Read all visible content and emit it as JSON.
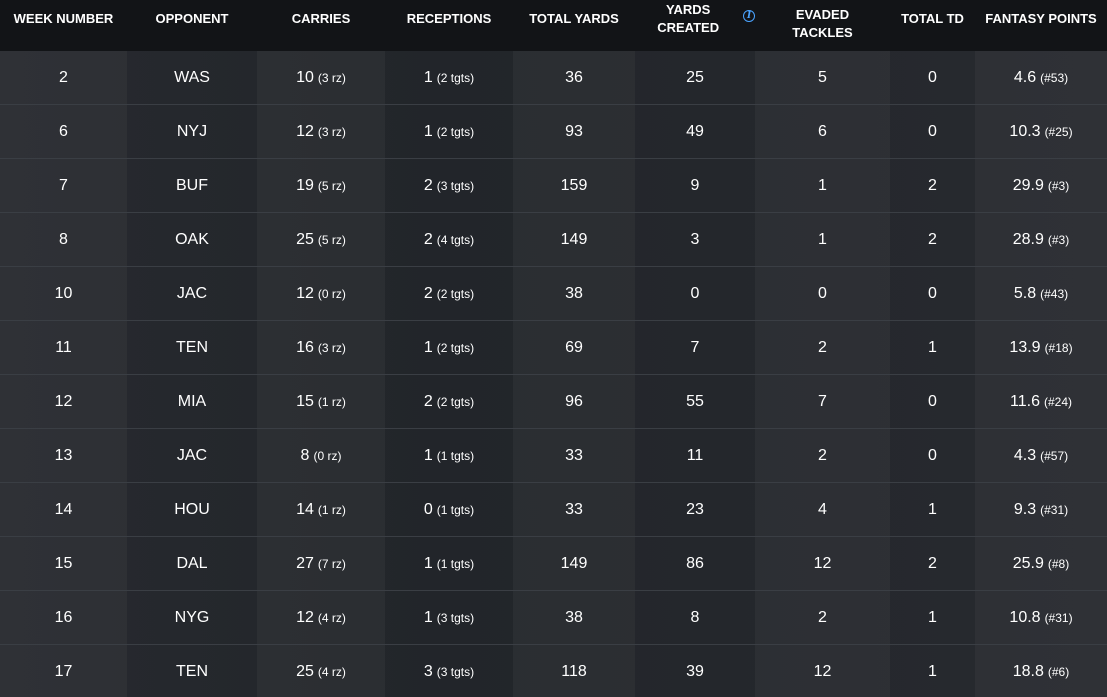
{
  "header": {
    "week": "WEEK NUMBER",
    "opponent": "OPPONENT",
    "carries": "CARRIES",
    "receptions": "RECEPTIONS",
    "total_yards": "TOTAL YARDS",
    "yards_created": "YARDS CREATED",
    "evaded_line1": "EVADED",
    "evaded_line2": "TACKLES",
    "total_td": "TOTAL TD",
    "fantasy_points": "FANTASY POINTS",
    "info_icon": "i"
  },
  "rows": [
    {
      "week": "2",
      "opp": "WAS",
      "carries": "10",
      "carries_rz": "(3 rz)",
      "rec": "1",
      "rec_tgts": "(2 tgts)",
      "yards": "36",
      "created": "25",
      "evaded": "5",
      "td": "0",
      "fp": "4.6",
      "fp_rank": "(#53)"
    },
    {
      "week": "6",
      "opp": "NYJ",
      "carries": "12",
      "carries_rz": "(3 rz)",
      "rec": "1",
      "rec_tgts": "(2 tgts)",
      "yards": "93",
      "created": "49",
      "evaded": "6",
      "td": "0",
      "fp": "10.3",
      "fp_rank": "(#25)"
    },
    {
      "week": "7",
      "opp": "BUF",
      "carries": "19",
      "carries_rz": "(5 rz)",
      "rec": "2",
      "rec_tgts": "(3 tgts)",
      "yards": "159",
      "created": "9",
      "evaded": "1",
      "td": "2",
      "fp": "29.9",
      "fp_rank": "(#3)"
    },
    {
      "week": "8",
      "opp": "OAK",
      "carries": "25",
      "carries_rz": "(5 rz)",
      "rec": "2",
      "rec_tgts": "(4 tgts)",
      "yards": "149",
      "created": "3",
      "evaded": "1",
      "td": "2",
      "fp": "28.9",
      "fp_rank": "(#3)"
    },
    {
      "week": "10",
      "opp": "JAC",
      "carries": "12",
      "carries_rz": "(0 rz)",
      "rec": "2",
      "rec_tgts": "(2 tgts)",
      "yards": "38",
      "created": "0",
      "evaded": "0",
      "td": "0",
      "fp": "5.8",
      "fp_rank": "(#43)"
    },
    {
      "week": "11",
      "opp": "TEN",
      "carries": "16",
      "carries_rz": "(3 rz)",
      "rec": "1",
      "rec_tgts": "(2 tgts)",
      "yards": "69",
      "created": "7",
      "evaded": "2",
      "td": "1",
      "fp": "13.9",
      "fp_rank": "(#18)"
    },
    {
      "week": "12",
      "opp": "MIA",
      "carries": "15",
      "carries_rz": "(1 rz)",
      "rec": "2",
      "rec_tgts": "(2 tgts)",
      "yards": "96",
      "created": "55",
      "evaded": "7",
      "td": "0",
      "fp": "11.6",
      "fp_rank": "(#24)"
    },
    {
      "week": "13",
      "opp": "JAC",
      "carries": "8",
      "carries_rz": "(0 rz)",
      "rec": "1",
      "rec_tgts": "(1 tgts)",
      "yards": "33",
      "created": "11",
      "evaded": "2",
      "td": "0",
      "fp": "4.3",
      "fp_rank": "(#57)"
    },
    {
      "week": "14",
      "opp": "HOU",
      "carries": "14",
      "carries_rz": "(1 rz)",
      "rec": "0",
      "rec_tgts": "(1 tgts)",
      "yards": "33",
      "created": "23",
      "evaded": "4",
      "td": "1",
      "fp": "9.3",
      "fp_rank": "(#31)"
    },
    {
      "week": "15",
      "opp": "DAL",
      "carries": "27",
      "carries_rz": "(7 rz)",
      "rec": "1",
      "rec_tgts": "(1 tgts)",
      "yards": "149",
      "created": "86",
      "evaded": "12",
      "td": "2",
      "fp": "25.9",
      "fp_rank": "(#8)"
    },
    {
      "week": "16",
      "opp": "NYG",
      "carries": "12",
      "carries_rz": "(4 rz)",
      "rec": "1",
      "rec_tgts": "(3 tgts)",
      "yards": "38",
      "created": "8",
      "evaded": "2",
      "td": "1",
      "fp": "10.8",
      "fp_rank": "(#31)"
    },
    {
      "week": "17",
      "opp": "TEN",
      "carries": "25",
      "carries_rz": "(4 rz)",
      "rec": "3",
      "rec_tgts": "(3 tgts)",
      "yards": "118",
      "created": "39",
      "evaded": "12",
      "td": "1",
      "fp": "18.8",
      "fp_rank": "(#6)"
    }
  ],
  "colors": {
    "header_bg": "#121417",
    "row_bg": "#26292e",
    "divider": "#3a3e44",
    "info_icon": "#4aa3ff"
  }
}
